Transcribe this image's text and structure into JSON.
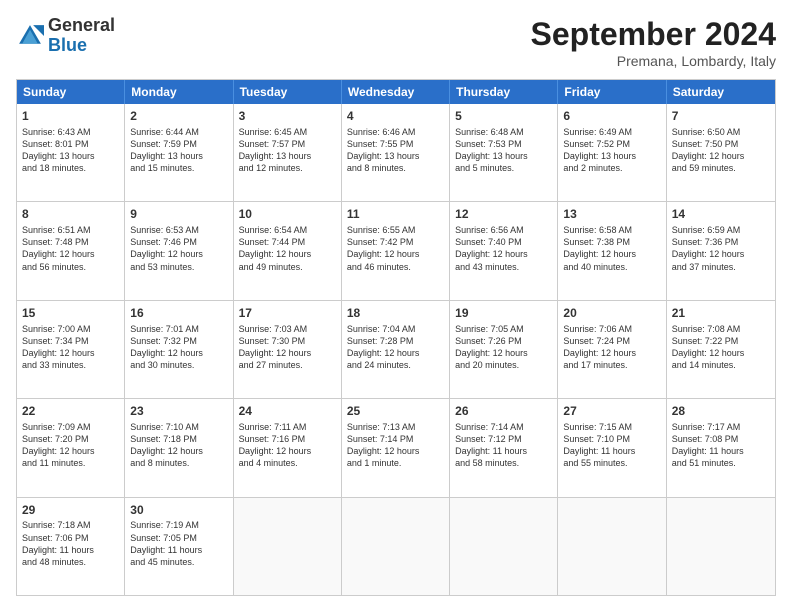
{
  "logo": {
    "general": "General",
    "blue": "Blue"
  },
  "header": {
    "month": "September 2024",
    "location": "Premana, Lombardy, Italy"
  },
  "days": [
    "Sunday",
    "Monday",
    "Tuesday",
    "Wednesday",
    "Thursday",
    "Friday",
    "Saturday"
  ],
  "rows": [
    [
      {
        "day": "1",
        "lines": [
          "Sunrise: 6:43 AM",
          "Sunset: 8:01 PM",
          "Daylight: 13 hours",
          "and 18 minutes."
        ]
      },
      {
        "day": "2",
        "lines": [
          "Sunrise: 6:44 AM",
          "Sunset: 7:59 PM",
          "Daylight: 13 hours",
          "and 15 minutes."
        ]
      },
      {
        "day": "3",
        "lines": [
          "Sunrise: 6:45 AM",
          "Sunset: 7:57 PM",
          "Daylight: 13 hours",
          "and 12 minutes."
        ]
      },
      {
        "day": "4",
        "lines": [
          "Sunrise: 6:46 AM",
          "Sunset: 7:55 PM",
          "Daylight: 13 hours",
          "and 8 minutes."
        ]
      },
      {
        "day": "5",
        "lines": [
          "Sunrise: 6:48 AM",
          "Sunset: 7:53 PM",
          "Daylight: 13 hours",
          "and 5 minutes."
        ]
      },
      {
        "day": "6",
        "lines": [
          "Sunrise: 6:49 AM",
          "Sunset: 7:52 PM",
          "Daylight: 13 hours",
          "and 2 minutes."
        ]
      },
      {
        "day": "7",
        "lines": [
          "Sunrise: 6:50 AM",
          "Sunset: 7:50 PM",
          "Daylight: 12 hours",
          "and 59 minutes."
        ]
      }
    ],
    [
      {
        "day": "8",
        "lines": [
          "Sunrise: 6:51 AM",
          "Sunset: 7:48 PM",
          "Daylight: 12 hours",
          "and 56 minutes."
        ]
      },
      {
        "day": "9",
        "lines": [
          "Sunrise: 6:53 AM",
          "Sunset: 7:46 PM",
          "Daylight: 12 hours",
          "and 53 minutes."
        ]
      },
      {
        "day": "10",
        "lines": [
          "Sunrise: 6:54 AM",
          "Sunset: 7:44 PM",
          "Daylight: 12 hours",
          "and 49 minutes."
        ]
      },
      {
        "day": "11",
        "lines": [
          "Sunrise: 6:55 AM",
          "Sunset: 7:42 PM",
          "Daylight: 12 hours",
          "and 46 minutes."
        ]
      },
      {
        "day": "12",
        "lines": [
          "Sunrise: 6:56 AM",
          "Sunset: 7:40 PM",
          "Daylight: 12 hours",
          "and 43 minutes."
        ]
      },
      {
        "day": "13",
        "lines": [
          "Sunrise: 6:58 AM",
          "Sunset: 7:38 PM",
          "Daylight: 12 hours",
          "and 40 minutes."
        ]
      },
      {
        "day": "14",
        "lines": [
          "Sunrise: 6:59 AM",
          "Sunset: 7:36 PM",
          "Daylight: 12 hours",
          "and 37 minutes."
        ]
      }
    ],
    [
      {
        "day": "15",
        "lines": [
          "Sunrise: 7:00 AM",
          "Sunset: 7:34 PM",
          "Daylight: 12 hours",
          "and 33 minutes."
        ]
      },
      {
        "day": "16",
        "lines": [
          "Sunrise: 7:01 AM",
          "Sunset: 7:32 PM",
          "Daylight: 12 hours",
          "and 30 minutes."
        ]
      },
      {
        "day": "17",
        "lines": [
          "Sunrise: 7:03 AM",
          "Sunset: 7:30 PM",
          "Daylight: 12 hours",
          "and 27 minutes."
        ]
      },
      {
        "day": "18",
        "lines": [
          "Sunrise: 7:04 AM",
          "Sunset: 7:28 PM",
          "Daylight: 12 hours",
          "and 24 minutes."
        ]
      },
      {
        "day": "19",
        "lines": [
          "Sunrise: 7:05 AM",
          "Sunset: 7:26 PM",
          "Daylight: 12 hours",
          "and 20 minutes."
        ]
      },
      {
        "day": "20",
        "lines": [
          "Sunrise: 7:06 AM",
          "Sunset: 7:24 PM",
          "Daylight: 12 hours",
          "and 17 minutes."
        ]
      },
      {
        "day": "21",
        "lines": [
          "Sunrise: 7:08 AM",
          "Sunset: 7:22 PM",
          "Daylight: 12 hours",
          "and 14 minutes."
        ]
      }
    ],
    [
      {
        "day": "22",
        "lines": [
          "Sunrise: 7:09 AM",
          "Sunset: 7:20 PM",
          "Daylight: 12 hours",
          "and 11 minutes."
        ]
      },
      {
        "day": "23",
        "lines": [
          "Sunrise: 7:10 AM",
          "Sunset: 7:18 PM",
          "Daylight: 12 hours",
          "and 8 minutes."
        ]
      },
      {
        "day": "24",
        "lines": [
          "Sunrise: 7:11 AM",
          "Sunset: 7:16 PM",
          "Daylight: 12 hours",
          "and 4 minutes."
        ]
      },
      {
        "day": "25",
        "lines": [
          "Sunrise: 7:13 AM",
          "Sunset: 7:14 PM",
          "Daylight: 12 hours",
          "and 1 minute."
        ]
      },
      {
        "day": "26",
        "lines": [
          "Sunrise: 7:14 AM",
          "Sunset: 7:12 PM",
          "Daylight: 11 hours",
          "and 58 minutes."
        ]
      },
      {
        "day": "27",
        "lines": [
          "Sunrise: 7:15 AM",
          "Sunset: 7:10 PM",
          "Daylight: 11 hours",
          "and 55 minutes."
        ]
      },
      {
        "day": "28",
        "lines": [
          "Sunrise: 7:17 AM",
          "Sunset: 7:08 PM",
          "Daylight: 11 hours",
          "and 51 minutes."
        ]
      }
    ],
    [
      {
        "day": "29",
        "lines": [
          "Sunrise: 7:18 AM",
          "Sunset: 7:06 PM",
          "Daylight: 11 hours",
          "and 48 minutes."
        ]
      },
      {
        "day": "30",
        "lines": [
          "Sunrise: 7:19 AM",
          "Sunset: 7:05 PM",
          "Daylight: 11 hours",
          "and 45 minutes."
        ]
      },
      {
        "day": "",
        "lines": []
      },
      {
        "day": "",
        "lines": []
      },
      {
        "day": "",
        "lines": []
      },
      {
        "day": "",
        "lines": []
      },
      {
        "day": "",
        "lines": []
      }
    ]
  ]
}
